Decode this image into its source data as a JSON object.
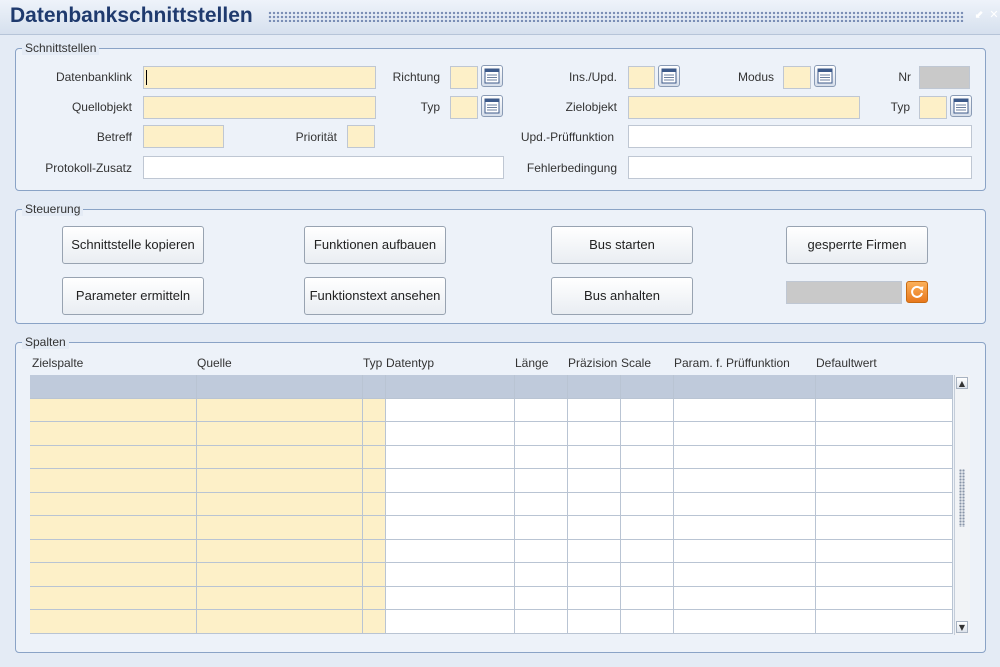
{
  "window": {
    "title": "Datenbankschnittstellen",
    "minimize_glyph": "⬋",
    "close_glyph": "✕"
  },
  "schnittstellen": {
    "legend": "Schnittstellen",
    "labels": {
      "datenbanklink": "Datenbanklink",
      "richtung": "Richtung",
      "ins_upd": "Ins./Upd.",
      "modus": "Modus",
      "nr": "Nr",
      "quellobjekt": "Quellobjekt",
      "typ": "Typ",
      "zielobjekt": "Zielobjekt",
      "typ2": "Typ",
      "betreff": "Betreff",
      "prioritaet": "Priorität",
      "upd_pruef": "Upd.-Prüffunktion",
      "protokoll": "Protokoll-Zusatz",
      "fehler": "Fehlerbedingung"
    },
    "values": {
      "datenbanklink": "",
      "richtung": "",
      "ins_upd": "",
      "modus": "",
      "nr": "",
      "quellobjekt": "",
      "typ": "",
      "zielobjekt": "",
      "typ2": "",
      "betreff": "",
      "prioritaet": "",
      "upd_pruef": "",
      "protokoll": "",
      "fehler": ""
    }
  },
  "steuerung": {
    "legend": "Steuerung",
    "buttons": {
      "schnittstelle_kopieren": "Schnittstelle kopieren",
      "funktionen_aufbauen": "Funktionen aufbauen",
      "bus_starten": "Bus starten",
      "gesperrte_firmen": "gesperrte Firmen",
      "parameter_ermitteln": "Parameter ermitteln",
      "funktionstext_ansehen": "Funktionstext ansehen",
      "bus_anhalten": "Bus anhalten"
    },
    "status_value": ""
  },
  "spalten": {
    "legend": "Spalten",
    "columns": [
      "Zielspalte",
      "Quelle",
      "Typ",
      "Datentyp",
      "Länge",
      "Präzision",
      "Scale",
      "Param. f. Prüffunktion",
      "Defaultwert"
    ],
    "row_count": 11
  },
  "colors": {
    "accent": "#1f3a6e",
    "field_required": "#fdf0c8",
    "field_readonly": "#c9c9c9",
    "selected_row": "#bfcadb"
  },
  "icons": {
    "calendar": "calendar-list-icon",
    "refresh": "refresh-icon"
  }
}
